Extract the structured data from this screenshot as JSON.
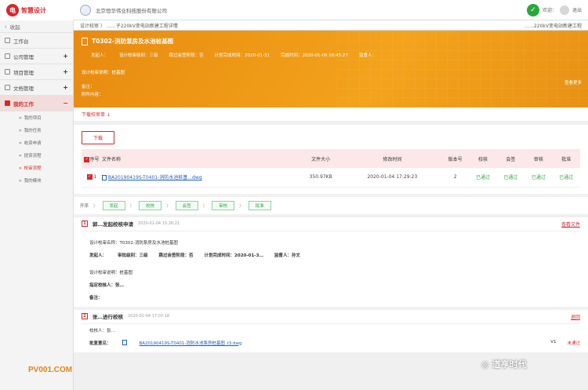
{
  "header": {
    "logo_mark": "电",
    "logo_text": "智慧设计",
    "company": "北京恒华伟业科技股份有限公司",
    "welcome": "欢迎：",
    "exit": "退出"
  },
  "sidebar": {
    "collapse": "收起",
    "items": [
      {
        "label": "工作台",
        "has_plus": false
      },
      {
        "label": "公司管理",
        "has_plus": true
      },
      {
        "label": "项目管理",
        "has_plus": true
      },
      {
        "label": "文档管理",
        "has_plus": true
      },
      {
        "label": "我的工作",
        "has_plus": true
      }
    ],
    "subitems": [
      "我的项目",
      "我的任务",
      "收资申请",
      "提资流程",
      "校审流程",
      "我的模块"
    ],
    "active_sub_index": 4
  },
  "crumb": {
    "left": "设计校审 〉 ……子220kV变电站新建工程详情",
    "right": "……220kV变电站新建工程"
  },
  "banner": {
    "title": "T0302-消防泵房及水池桩基图",
    "meta": [
      "发起人：",
      "设计校审级别：三级",
      "跳过会签阶段：否",
      "计划完成时间：2020-01-31",
      "完成时间：2020-01-06 10:45:27",
      "监督人："
    ],
    "desc": "设计校审说明：桩基图",
    "link": "查看更多",
    "rows": [
      "备注：",
      "附件内容："
    ]
  },
  "download_list": "下载校审单 ↓",
  "download_btn": "下载",
  "table": {
    "headers": [
      "序号",
      "文件名称",
      "文件大小",
      "修改时间",
      "版本号",
      "校核",
      "会签",
      "审核",
      "批准"
    ],
    "rows": [
      {
        "idx": "1",
        "name": "BA20190419S-T0401-消防水池桩基...dwg",
        "size": "350.97KB",
        "time": "2020-01-04 17:29:23",
        "ver": "2",
        "s1": "已通过",
        "s2": "已通过",
        "s3": "已通过",
        "s4": "已通过"
      }
    ]
  },
  "steps": {
    "label": "开序",
    "items": [
      "发起",
      "校核",
      "会签",
      "审核",
      "批准"
    ]
  },
  "sec1": {
    "num": "1",
    "title": "郭…发起校核申请",
    "time": "2020-01-04 15:26:21",
    "action": "查看文件",
    "r1": "设计校审名称：T0302-消防泵房及水池桩基图",
    "r2a": "发起人：",
    "r2b": "审批级别：三级",
    "r2c": "跳过会签阶段：否",
    "r2d": "计划完成时间：2020-01-3…",
    "r2e": "监督人：孙文",
    "r3": "设计校审说明：桩基图",
    "r4": "指定校核人：张…",
    "r5": "备注："
  },
  "sec2": {
    "num": "2",
    "title": "张…进行校核",
    "time": "2020-01-04 17:07:18",
    "action": "退回",
    "r1": "校核人：张…",
    "r2label": "批复意见：",
    "r2file": "BA20190419S-T0401-消防水池泵房桩基图_t3.dwg",
    "r2ver": "V1",
    "r2status": "未通过"
  },
  "watermark": {
    "left": "PV001.COM",
    "right": "道亨时代"
  }
}
